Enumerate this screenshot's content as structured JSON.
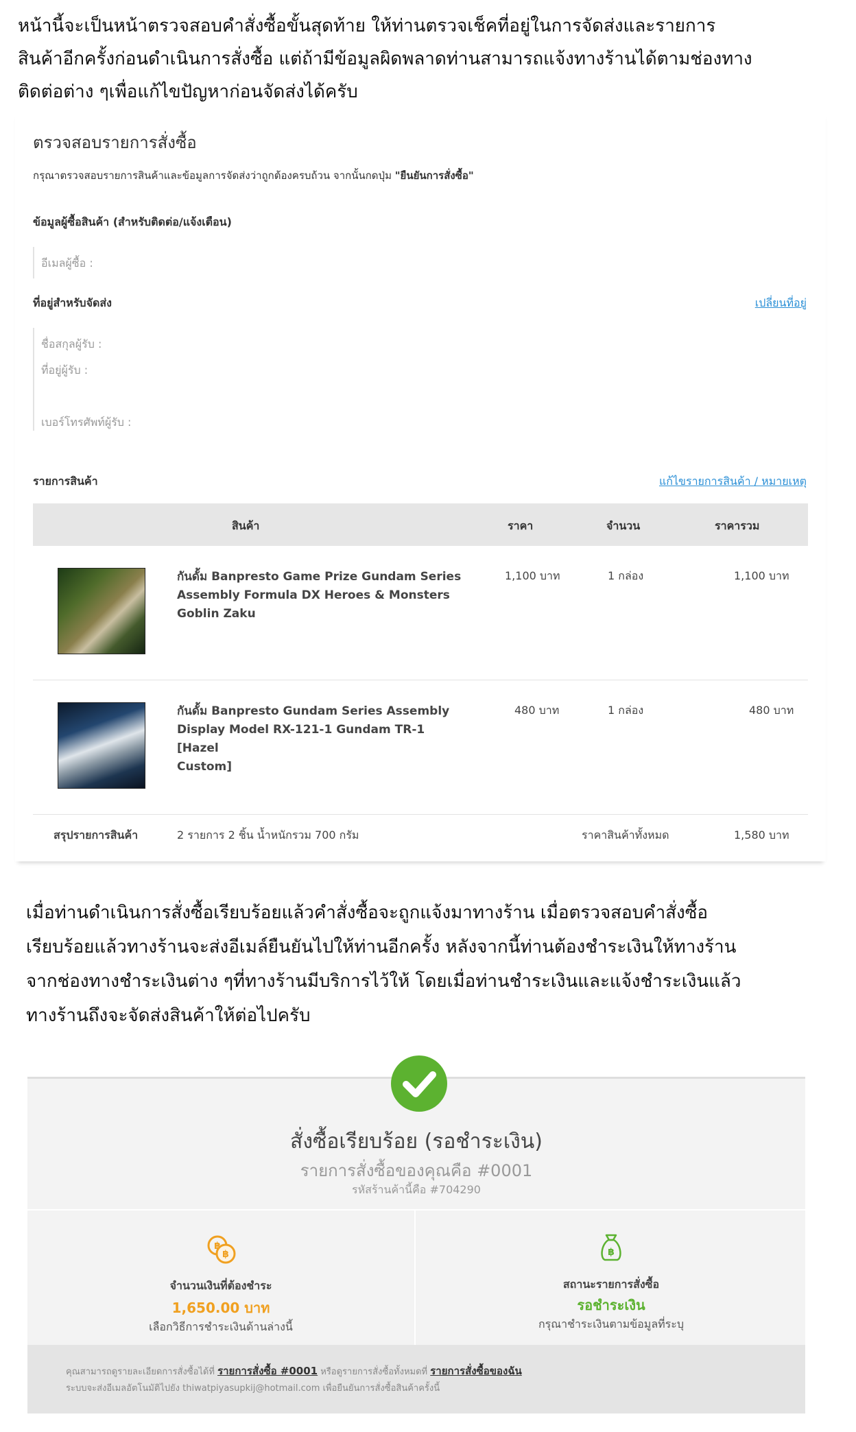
{
  "intro": {
    "line1": "หน้านี้จะเป็นหน้าตรวจสอบคำสั่งซื้อขั้นสุดท้าย ให้ท่านตรวจเช็คที่อยู่ในการจัดส่งและรายการ",
    "line2": "สินค้าอีกครั้งก่อนดำเนินการสั่งซื้อ แต่ถ้ามีข้อมูลผิดพลาดท่านสามารถแจ้งทางร้านได้ตามช่องทาง",
    "line3": "ติดต่อต่าง ๆเพื่อแก้ไขปัญหาก่อนจัดส่งได้ครับ"
  },
  "checkout": {
    "title": "ตรวจสอบรายการสั่งซื้อ",
    "subtitle_prefix": "กรุณาตรวจสอบรายการสินค้าและข้อมูลการจัดส่งว่าถูกต้องครบถ้วน จากนั้นกดปุ่ม ",
    "subtitle_button": "\"ยืนยันการสั่งซื้อ\"",
    "buyer_heading": "ข้อมูลผู้ซื้อสินค้า (สำหรับติดต่อ/แจ้งเตือน)",
    "buyer_email_label": "อีเมลผู้ซื้อ :",
    "shipping_heading": "ที่อยู่สำหรับจัดส่ง",
    "change_address_link": "เปลี่ยนที่อยู่",
    "recipient_name_label": "ชื่อสกุลผู้รับ :",
    "recipient_address_label": "ที่อยู่ผู้รับ :",
    "recipient_phone_label": "เบอร์โทรศัพท์ผู้รับ :",
    "items_heading": "รายการสินค้า",
    "edit_items_link": "แก้ไขรายการสินค้า / หมายเหตุ",
    "columns": {
      "product": "สินค้า",
      "price": "ราคา",
      "quantity": "จำนวน",
      "total": "ราคารวม"
    },
    "items": [
      {
        "name_line1": "กันดั้ม Banpresto Game Prize Gundam Series",
        "name_line2": "Assembly Formula DX Heroes & Monsters",
        "name_line3": "Goblin Zaku",
        "price": "1,100 บาท",
        "quantity": "1 กล่อง",
        "total": "1,100 บาท"
      },
      {
        "name_line1": "กันดั้ม Banpresto Gundam Series Assembly",
        "name_line2": "Display Model RX-121-1 Gundam TR-1 [Hazel",
        "name_line3": "Custom]",
        "price": "480 บาท",
        "quantity": "1 กล่อง",
        "total": "480 บาท"
      }
    ],
    "summary": {
      "label": "สรุปรายการสินค้า",
      "details": "2 รายการ 2 ชิ้น น้ำหนักรวม 700 กรัม",
      "total_label": "ราคาสินค้าทั้งหมด",
      "total_value": "1,580 บาท"
    }
  },
  "middle": {
    "line1": "เมื่อท่านดำเนินการสั่งซื้อเรียบร้อยแล้วคำสั่งซื้อจะถูกแจ้งมาทางร้าน เมื่อตรวจสอบคำสั่งซื้อ",
    "line2": "เรียบร้อยแล้วทางร้านจะส่งอีเมล์ยืนยันไปให้ท่านอีกครั้ง หลังจากนี้ท่านต้องชำระเงินให้ทางร้าน",
    "line3": "จากช่องทางชำระเงินต่าง ๆที่ทางร้านมีบริการไว้ให้ โดยเมื่อท่านชำระเงินและแจ้งชำระเงินแล้ว",
    "line4": "ทางร้านถึงจะจัดส่งสินค้าให้ต่อไปครับ"
  },
  "confirmation": {
    "title": "สั่งซื้อเรียบร้อย (รอชำระเงิน)",
    "order_line": "รายการสั่งซื้อของคุณคือ #0001",
    "shop_code": "รหัสร้านค้านี้คือ #704290",
    "amount_label": "จำนวนเงินที่ต้องชำระ",
    "amount_value": "1,650.00 บาท",
    "amount_note": "เลือกวิธีการชำระเงินด้านล่างนี้",
    "status_label": "สถานะรายการสั่งซื้อ",
    "status_value": "รอชำระเงิน",
    "status_note": "กรุณาชำระเงินตามข้อมูลที่ระบุ",
    "footer_text1": "คุณสามารถดูรายละเอียดการสั่งซื้อได้ที่ ",
    "footer_link1": "รายการสั่งซื้อ #0001",
    "footer_text2": " หรือดูรายการสั่งซื้อทั้งหมดที่ ",
    "footer_link2": "รายการสั่งซื้อของฉัน",
    "footer_line2": "ระบบจะส่งอีเมลอัตโนมัติไปยัง thiwatpiyasupkij@hotmail.com เพื่อยืนยันการสั่งซื้อสินค้าครั้งนี้"
  },
  "colors": {
    "link": "#2a8fd6",
    "amount": "#f0a020",
    "status": "#5cb230",
    "check": "#5cb230"
  }
}
